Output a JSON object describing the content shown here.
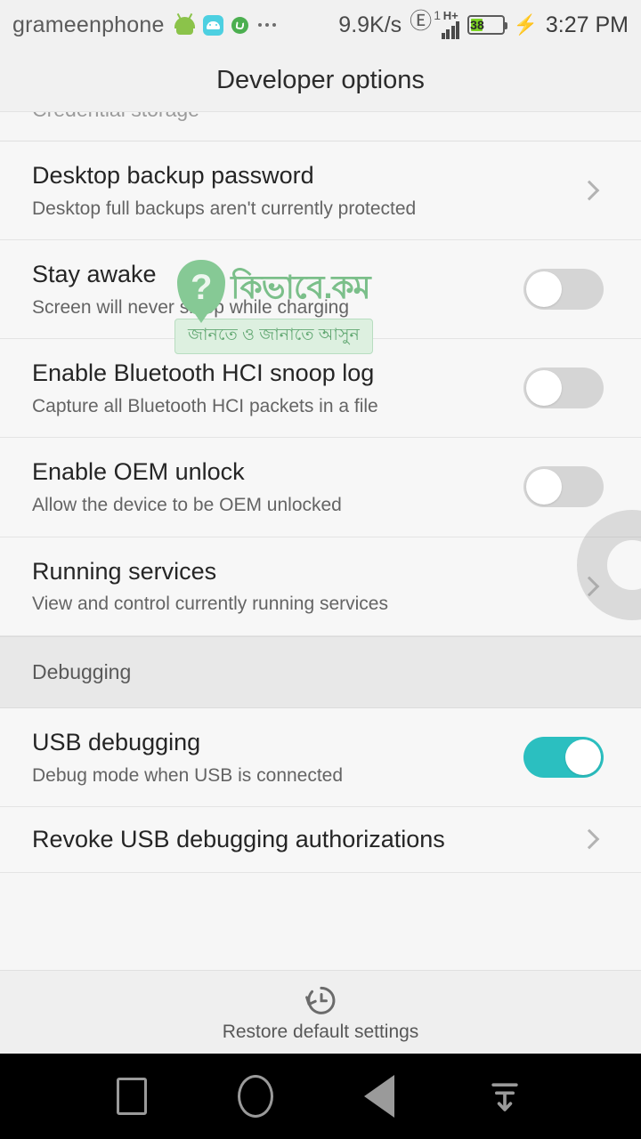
{
  "status_bar": {
    "carrier": "grameenphone",
    "icons": [
      "android-robot-icon",
      "android-app-icon",
      "whatsapp-icon",
      "overflow-dots-icon"
    ],
    "network_speed": "9.9K/s",
    "sim_slot": "1",
    "network_type": "H+",
    "signal_bars": 4,
    "battery_percent": "38",
    "battery_charging": true,
    "time": "3:27 PM"
  },
  "header": {
    "title": "Developer options"
  },
  "cut_off_row": {
    "label": "Credential storage"
  },
  "rows": [
    {
      "name": "desktop-backup-password",
      "title": "Desktop backup password",
      "subtitle": "Desktop full backups aren't currently protected",
      "control": "chevron"
    },
    {
      "name": "stay-awake",
      "title": "Stay awake",
      "subtitle": "Screen will never sleep while charging",
      "control": "switch",
      "checked": false
    },
    {
      "name": "bluetooth-hci-snoop-log",
      "title": "Enable Bluetooth HCI snoop log",
      "subtitle": "Capture all Bluetooth HCI packets in a file",
      "control": "switch",
      "checked": false
    },
    {
      "name": "enable-oem-unlock",
      "title": "Enable OEM unlock",
      "subtitle": "Allow the device to be OEM unlocked",
      "control": "switch",
      "checked": false
    },
    {
      "name": "running-services",
      "title": "Running services",
      "subtitle": "View and control currently running services",
      "control": "chevron"
    }
  ],
  "section_debugging": {
    "label": "Debugging"
  },
  "rows_debugging": [
    {
      "name": "usb-debugging",
      "title": "USB debugging",
      "subtitle": "Debug mode when USB is connected",
      "control": "switch",
      "checked": true
    },
    {
      "name": "revoke-usb-debugging-authorizations",
      "title": "Revoke USB debugging authorizations",
      "subtitle": "",
      "control": "chevron"
    }
  ],
  "footer": {
    "icon": "restore-history-icon",
    "label": "Restore default settings"
  },
  "navbar": {
    "recents": "recents-square-icon",
    "home": "home-circle-icon",
    "back": "back-triangle-icon",
    "pulldown": "pull-down-notifications-icon"
  },
  "watermark": {
    "brand": "কিভাবে.কম",
    "tagline": "জানতে ও জানাতে আসুন",
    "mark": "?"
  },
  "colors": {
    "switch_on": "#2bbfc0",
    "switch_off": "#d5d5d5",
    "battery_fill": "#7cd423",
    "page_bg": "#f7f7f7",
    "section_bg": "#e8e8e8",
    "watermark_green": "#7bbf8a"
  }
}
